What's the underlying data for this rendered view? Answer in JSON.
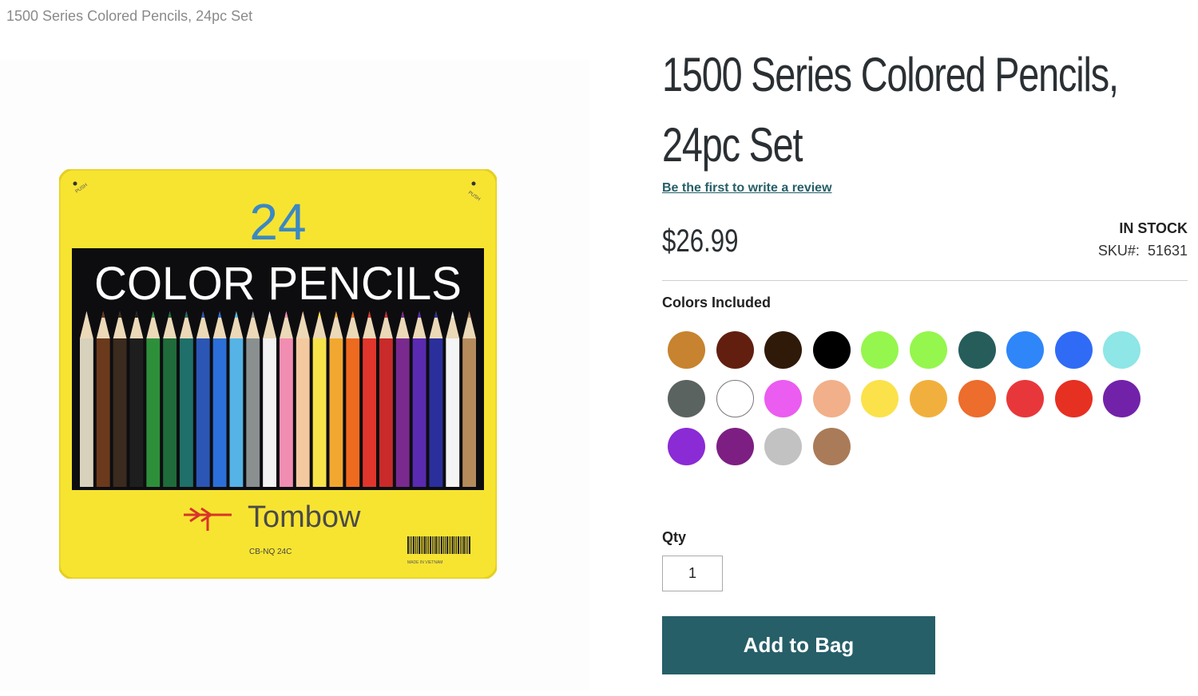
{
  "breadcrumb": "1500 Series Colored Pencils, 24pc Set",
  "product": {
    "title": "1500 Series Colored Pencils, 24pc Set",
    "review_link": "Be the first to write a review",
    "price": "$26.99",
    "stock": "IN STOCK",
    "sku_label": "SKU#:",
    "sku": "51631"
  },
  "image": {
    "count": "24",
    "heading": "COLOR PENCILS",
    "brand": "Tombow",
    "model": "CB-NQ 24C",
    "push": "PUSH",
    "made_in": "MADE IN VIETNAM"
  },
  "colors_label": "Colors Included",
  "swatches": [
    "#c7832f",
    "#621f10",
    "#2f1a0a",
    "#000000",
    "#95f64d",
    "#95f64d",
    "#265d5a",
    "#2f86f8",
    "#2f6bf5",
    "#8ee6e6",
    "#5b6361",
    "#ffffff",
    "#eb5cf0",
    "#f1b08a",
    "#fbe24a",
    "#f1b03d",
    "#ec6d2c",
    "#e8373b",
    "#e63022",
    "#7222a9",
    "#8a2bd6",
    "#7d1f82",
    "#c2c2c2",
    "#aa7b58"
  ],
  "pencil_colors": [
    "#d8d2bd",
    "#6b3a1c",
    "#3b2a1e",
    "#1e1e1e",
    "#2e8f3b",
    "#1f6b3a",
    "#1f6f6a",
    "#2b56b5",
    "#2c6fd8",
    "#55b3e6",
    "#8a8f90",
    "#f2f2f2",
    "#f28db2",
    "#f4c9a0",
    "#f7e24a",
    "#f2a830",
    "#ee6a1f",
    "#e0352a",
    "#c92a2a",
    "#7a2a8f",
    "#5a2ab0",
    "#2a2f9c",
    "#f4f4f4",
    "#b58b5c"
  ],
  "qty_label": "Qty",
  "qty_value": "1",
  "add_button": "Add to Bag"
}
